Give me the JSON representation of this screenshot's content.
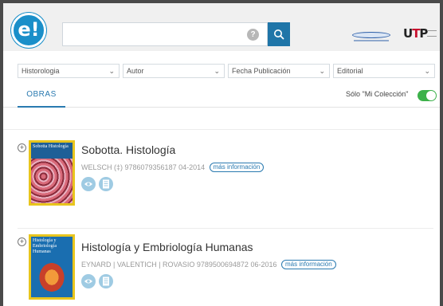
{
  "brand": {
    "logo_text": "e!",
    "partner_logo_icon": "library-logo-icon",
    "utp_logo_text": "UTP"
  },
  "search": {
    "value": "",
    "placeholder": "",
    "help_icon": "?"
  },
  "filters": [
    {
      "label": "Historologia",
      "icon": "chevron-down-icon"
    },
    {
      "label": "Autor",
      "icon": "chevron-down-icon"
    },
    {
      "label": "Fecha Publicación",
      "icon": "chevron-down-icon"
    },
    {
      "label": "Editorial",
      "icon": "chevron-down-icon"
    }
  ],
  "tabs": {
    "active": "OBRAS"
  },
  "collection_toggle": {
    "label": "Sólo \"Mi Colección\"",
    "on": true,
    "color": "#3cb14a"
  },
  "results": [
    {
      "title": "Sobotta. Histología",
      "meta": "WELSCH (‡) 9786079356187 04-2014",
      "more_label": "más información",
      "cover_text": "Sobotta Histología"
    },
    {
      "title": "Histología y Embriología Humanas",
      "meta": "EYNARD | VALENTICH | ROVASIO 9789500694872 06-2016",
      "more_label": "más información",
      "cover_text": "Histología y Embriología Humanas"
    }
  ],
  "colors": {
    "accent": "#2a7ab0",
    "search_button": "#1f75a8",
    "logo": "#1a8fc9"
  }
}
